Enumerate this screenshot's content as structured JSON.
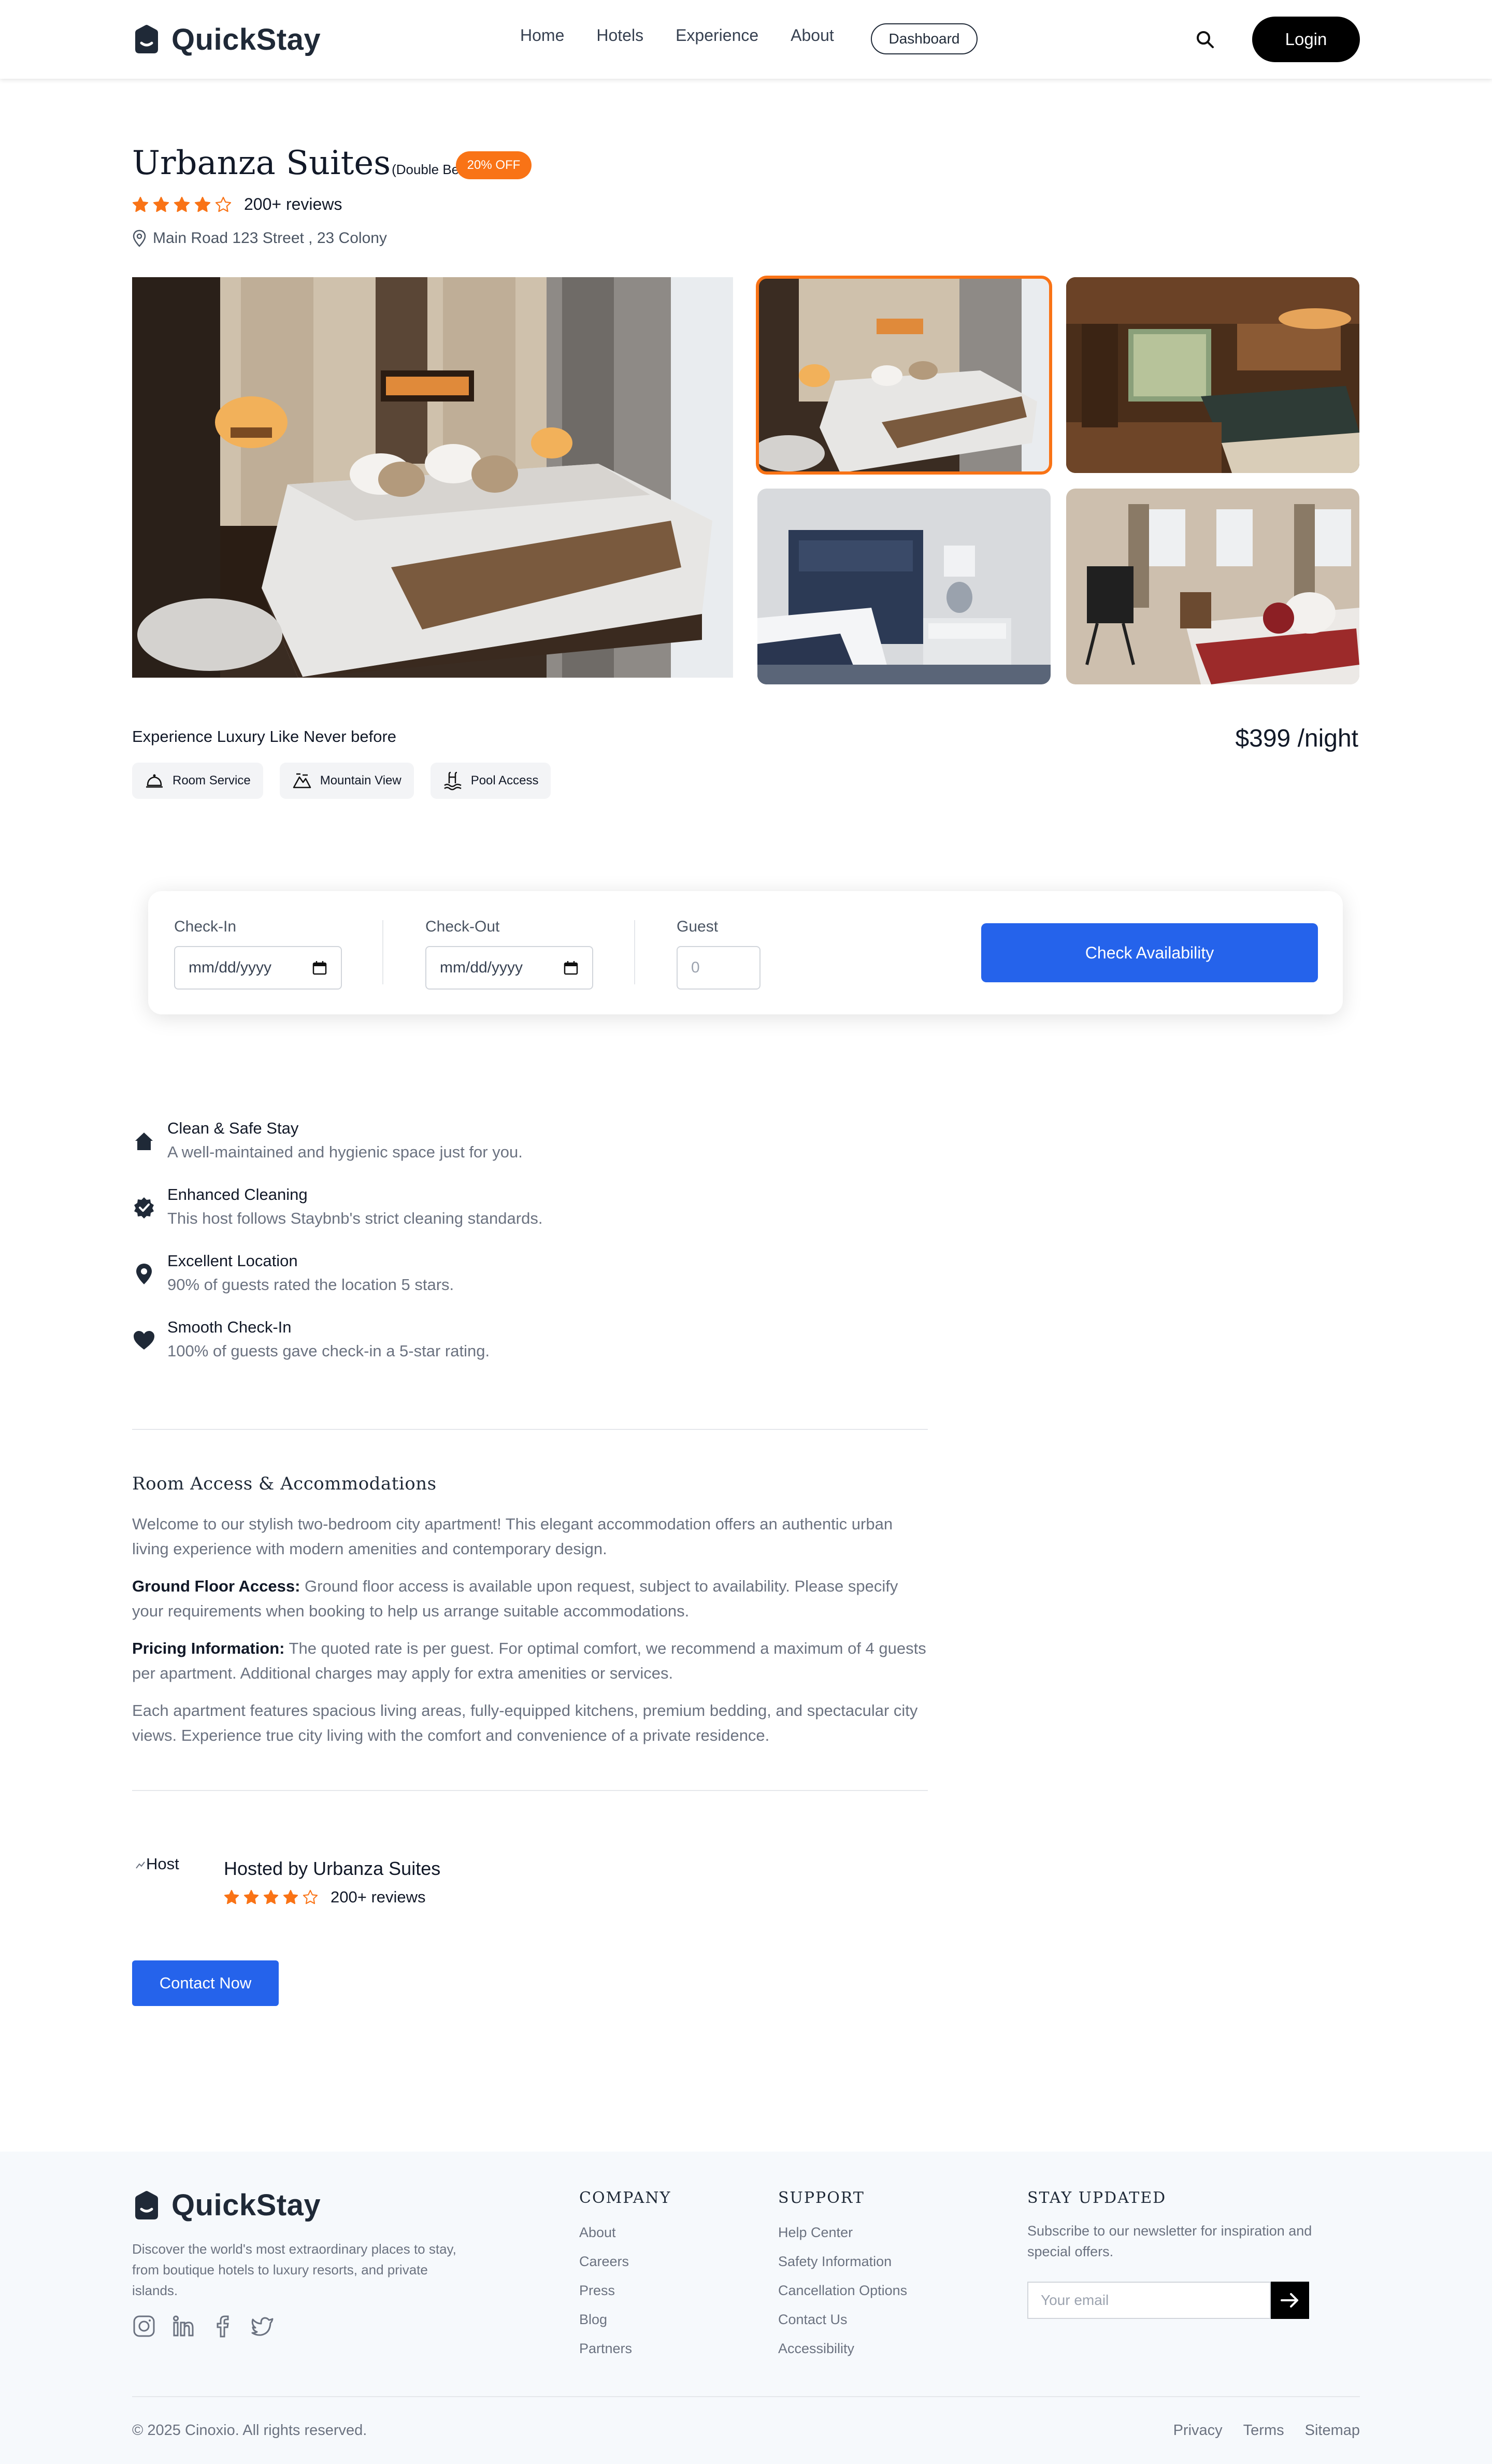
{
  "nav": {
    "brand": "QuickStay",
    "links": [
      "Home",
      "Hotels",
      "Experience",
      "About"
    ],
    "dashboard": "Dashboard",
    "login": "Login"
  },
  "hotel": {
    "name": "Urbanza Suites",
    "room_type": "(Double Bed)",
    "discount": "20% OFF",
    "rating": 4,
    "reviews": "200+ reviews",
    "address": "Main Road 123 Street , 23 Colony",
    "tagline": "Experience Luxury Like Never before",
    "price": "$399 /night",
    "amenities": [
      "Room Service",
      "Mountain View",
      "Pool Access"
    ]
  },
  "booking": {
    "checkin_label": "Check-In",
    "checkin_placeholder": "mm/dd/yyyy",
    "checkout_label": "Check-Out",
    "checkout_placeholder": "mm/dd/yyyy",
    "guest_label": "Guest",
    "guest_value": "0",
    "button": "Check Availability"
  },
  "highlights": [
    {
      "title": "Clean & Safe Stay",
      "desc": "A well-maintained and hygienic space just for you."
    },
    {
      "title": "Enhanced Cleaning",
      "desc": "This host follows Staybnb's strict cleaning standards."
    },
    {
      "title": "Excellent Location",
      "desc": "90% of guests rated the location 5 stars."
    },
    {
      "title": "Smooth Check-In",
      "desc": "100% of guests gave check-in a 5-star rating."
    }
  ],
  "description": {
    "title": "Room Access & Accommodations",
    "intro": "Welcome to our stylish two-bedroom city apartment! This elegant accommodation offers an authentic urban living experience with modern amenities and contemporary design.",
    "ground_label": "Ground Floor Access:",
    "ground_text": " Ground floor access is available upon request, subject to availability. Please specify your requirements when booking to help us arrange suitable accommodations.",
    "pricing_label": "Pricing Information:",
    "pricing_text": " The quoted rate is per guest. For optimal comfort, we recommend a maximum of 4 guests per apartment. Additional charges may apply for extra amenities or services.",
    "closing": "Each apartment features spacious living areas, fully-equipped kitchens, premium bedding, and spectacular city views. Experience true city living with the comfort and convenience of a private residence."
  },
  "host": {
    "img_alt": "Host",
    "name": "Hosted by Urbanza Suites",
    "rating": 4,
    "reviews": "200+ reviews",
    "contact": "Contact Now"
  },
  "footer": {
    "brand": "QuickStay",
    "description": "Discover the world's most extraordinary places to stay, from boutique hotels to luxury resorts, and private islands.",
    "company_title": "COMPANY",
    "company_links": [
      "About",
      "Careers",
      "Press",
      "Blog",
      "Partners"
    ],
    "support_title": "SUPPORT",
    "support_links": [
      "Help Center",
      "Safety Information",
      "Cancellation Options",
      "Contact Us",
      "Accessibility"
    ],
    "newsletter_title": "STAY UPDATED",
    "newsletter_desc": "Subscribe to our newsletter for inspiration and special offers.",
    "email_placeholder": "Your email",
    "copyright": "© 2025 Cinoxio. All rights reserved.",
    "bottom_links": [
      "Privacy",
      "Terms",
      "Sitemap"
    ]
  },
  "colors": {
    "accent": "#f97316",
    "primary": "#2563eb",
    "text": "#111827"
  }
}
